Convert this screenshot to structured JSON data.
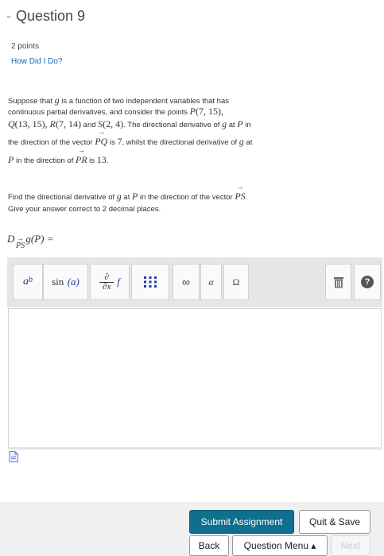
{
  "question": {
    "dash": "-",
    "title": "Question 9",
    "points": "2 points",
    "help_link": "How Did I Do?"
  },
  "body": {
    "l1_text": "Suppose that ",
    "l1_g": "g",
    "l1_text2": " is a function of two independent variables that has",
    "l2_text": "continuous partial derivatives, and consider the points ",
    "l2_p": "P",
    "l2_pcoords": "(7, 15),",
    "l3_q": "Q",
    "l3_qcoords": "(13, 15), ",
    "l3_r": "R",
    "l3_rcoords": "(7, 14)",
    "l3_and": " and ",
    "l3_s": "S",
    "l3_scoords": "(2, 4)",
    "l3_text": ". The directional derivative of ",
    "l3_g": "g",
    "l3_at": " at ",
    "l3_p": "P",
    "l3_in": " in",
    "l4_text": "the direction of the vector ",
    "l4_vec": "PQ",
    "l4_is": " is ",
    "l4_val": "7",
    "l4_text2": ", whilst the directional derivative of ",
    "l4_g": "g",
    "l4_at": " at",
    "l5_p": "P",
    "l5_text": " in the direction of ",
    "l5_vec": "PR",
    "l5_is": " is ",
    "l5_val": "13",
    "l5_dot": ".",
    "f1_text": "Find the directional derivative of ",
    "f1_g": "g",
    "f1_at": " at ",
    "f1_p": "P",
    "f1_text2": " in the direction of the vector ",
    "f1_vec": "PS",
    "f1_dot": ".",
    "f2_text": "Give your answer correct to 2 decimal places."
  },
  "derivative": {
    "d": "D",
    "sub": "PS",
    "rest": "g(P) ="
  },
  "toolbar": {
    "power_base": "a",
    "power_exp": "b",
    "sin_fn": "sin",
    "sin_arg": "(a)",
    "partial_num": "∂",
    "partial_den": "∂x",
    "partial_f": "f",
    "infinity": "∞",
    "alpha": "α",
    "omega": "Ω",
    "help": "?"
  },
  "footer": {
    "submit": "Submit Assignment",
    "quit": "Quit & Save",
    "back": "Back",
    "menu": "Question Menu ▴",
    "next": "Next"
  }
}
